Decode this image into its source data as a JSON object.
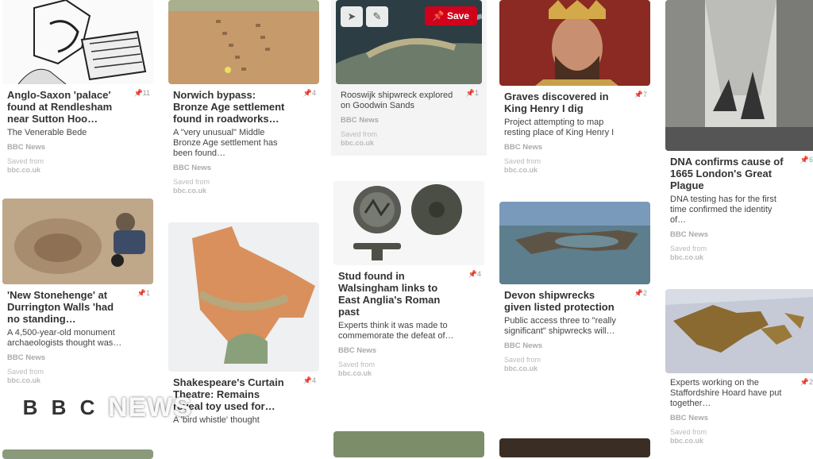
{
  "pins": {
    "anglo": {
      "title": "Anglo-Saxon 'palace' found at Rendlesham near Sutton Hoo…",
      "count": "11",
      "desc": "The Venerable Bede",
      "source": "BBC News",
      "saved": "Saved from",
      "url": "bbc.co.uk"
    },
    "norwich": {
      "title": "Norwich bypass: Bronze Age settlement found in roadworks…",
      "count": "4",
      "desc": "A \"very unusual\" Middle Bronze Age settlement has been found…",
      "source": "BBC News",
      "saved": "Saved from",
      "url": "bbc.co.uk"
    },
    "rooswijk": {
      "title": "",
      "count": "1",
      "desc": "Rooswijk shipwreck explored on Goodwin Sands",
      "source": "BBC News",
      "saved": "Saved from",
      "url": "bbc.co.uk",
      "save_label": "Save"
    },
    "graves": {
      "title": "Graves discovered in King Henry I dig",
      "count": "7",
      "desc": "Project attempting to map resting place of King Henry I",
      "source": "BBC News",
      "saved": "Saved from",
      "url": "bbc.co.uk"
    },
    "dna": {
      "title": "DNA confirms cause of 1665 London's Great Plague",
      "count": "6",
      "desc": "DNA testing has for the first time confirmed the identity of…",
      "source": "BBC News",
      "saved": "Saved from",
      "url": "bbc.co.uk"
    },
    "stonehenge": {
      "title": "'New Stonehenge' at Durrington Walls 'had no standing…",
      "count": "1",
      "desc": "A 4,500-year-old monument archaeologists thought was…",
      "source": "BBC News",
      "saved": "Saved from",
      "url": "bbc.co.uk"
    },
    "theatre": {
      "title": "Shakespeare's Curtain Theatre: Remains reveal toy used for…",
      "count": "4",
      "desc": "A 'bird whistle' thought",
      "source": "",
      "saved": "",
      "url": ""
    },
    "stud": {
      "title": "Stud found in Walsingham links to East Anglia's Roman past",
      "count": "4",
      "desc": "Experts think it was made to commemorate the defeat of…",
      "source": "BBC News",
      "saved": "Saved from",
      "url": "bbc.co.uk"
    },
    "devon": {
      "title": "Devon shipwrecks given listed protection",
      "count": "2",
      "desc": "Public access three to \"really significant\" shipwrecks will…",
      "source": "BBC News",
      "saved": "Saved from",
      "url": "bbc.co.uk"
    },
    "hoard": {
      "title": "",
      "count": "2",
      "desc": "Experts working on the Staffordshire Hoard have put together…",
      "source": "BBC News",
      "saved": "Saved from",
      "url": "bbc.co.uk"
    }
  },
  "watermark": {
    "b1": "B",
    "b2": "B",
    "b3": "C",
    "news": "NEWS"
  },
  "colors": {
    "save": "#d0021b",
    "bg": "#ffffff"
  }
}
